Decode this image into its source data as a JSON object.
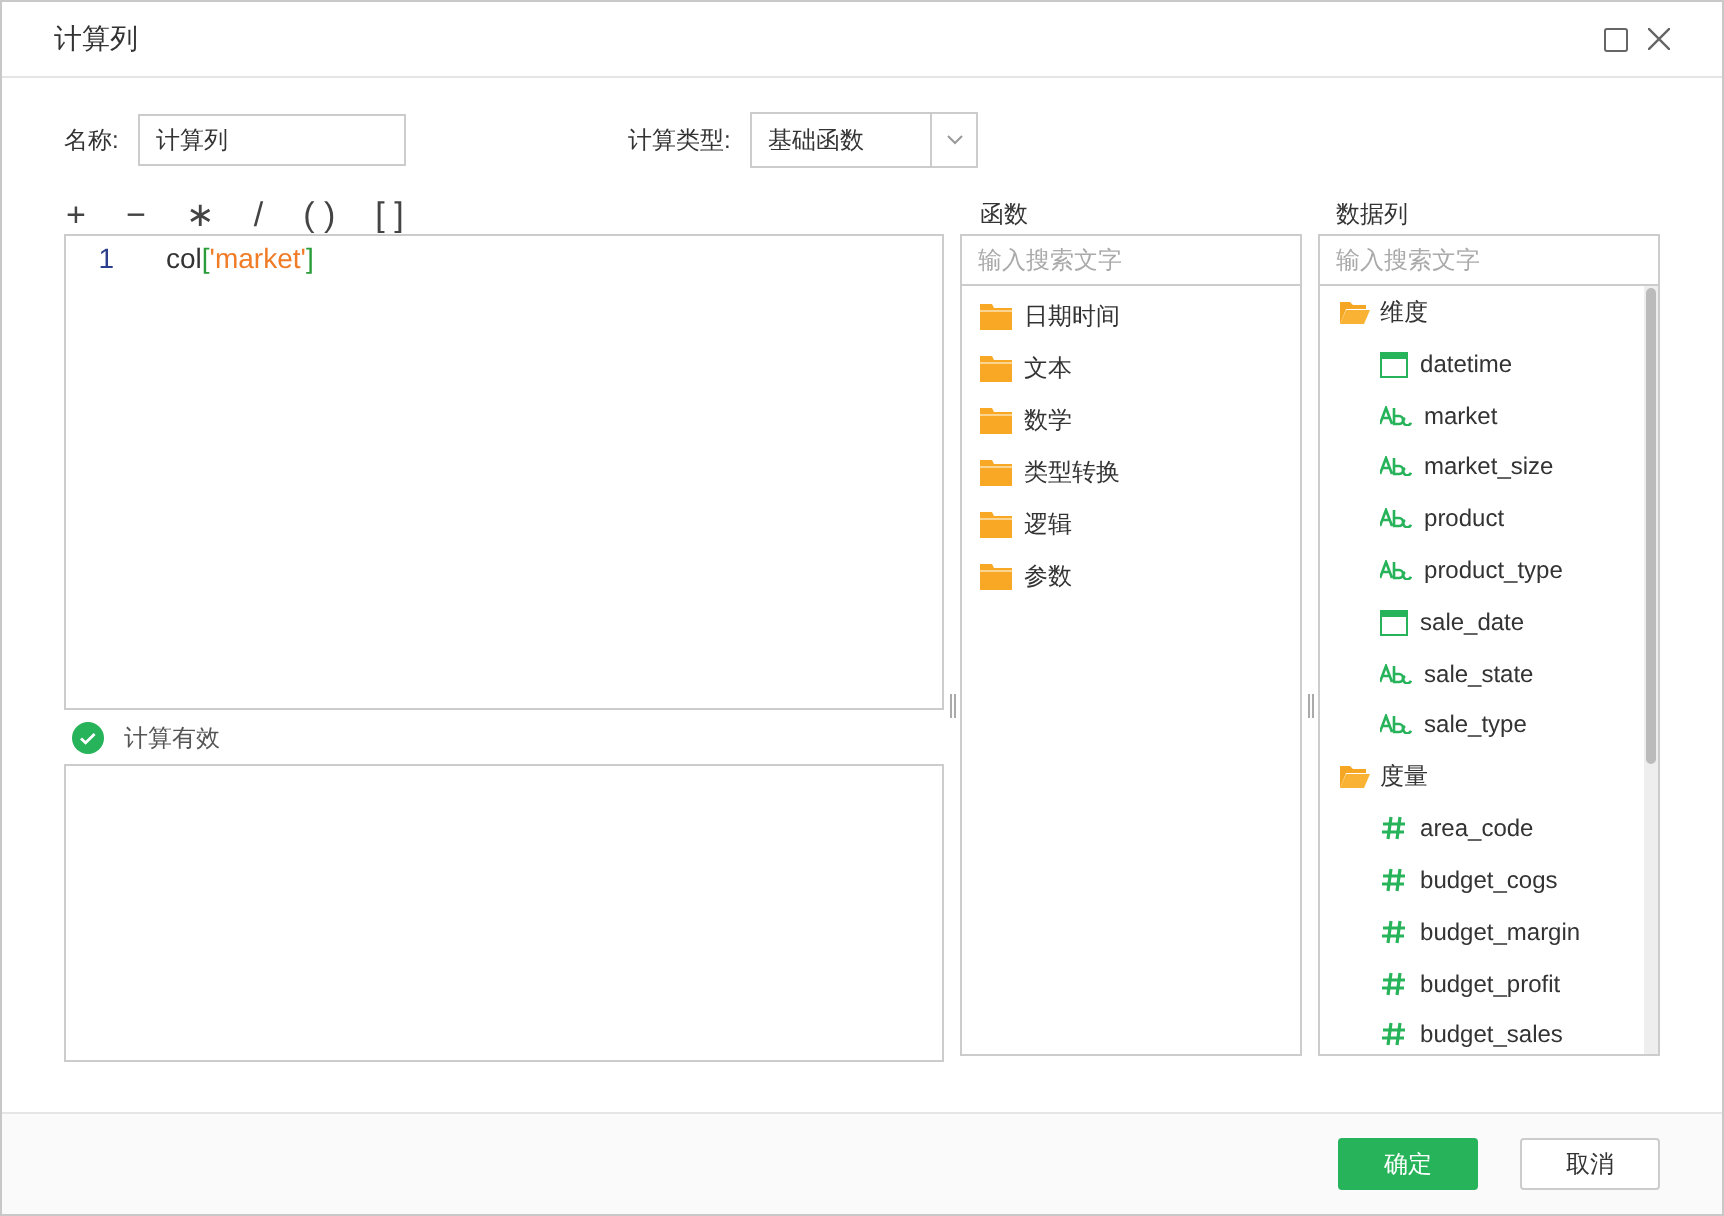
{
  "window": {
    "title": "计算列"
  },
  "name_field": {
    "label": "名称:",
    "value": "计算列"
  },
  "calc_type": {
    "label": "计算类型:",
    "value": "基础函数"
  },
  "operators": [
    "+",
    "−",
    "∗",
    "/",
    "( )",
    "[ ]"
  ],
  "editor": {
    "lines": [
      {
        "number": "1",
        "tokens": [
          {
            "kind": "ident",
            "text": "col"
          },
          {
            "kind": "bracket",
            "text": "["
          },
          {
            "kind": "string",
            "text": "'market'"
          },
          {
            "kind": "bracket",
            "text": "]"
          }
        ]
      }
    ]
  },
  "status": {
    "valid": true,
    "text": "计算有效"
  },
  "functions": {
    "title": "函数",
    "search_placeholder": "输入搜索文字",
    "items": [
      {
        "label": "日期时间",
        "expanded": false
      },
      {
        "label": "文本",
        "expanded": false
      },
      {
        "label": "数学",
        "expanded": false
      },
      {
        "label": "类型转换",
        "expanded": false
      },
      {
        "label": "逻辑",
        "expanded": false
      },
      {
        "label": "参数",
        "expanded": false
      }
    ]
  },
  "columns": {
    "title": "数据列",
    "search_placeholder": "输入搜索文字",
    "tree": [
      {
        "label": "维度",
        "expanded": true,
        "children": [
          {
            "label": "datetime",
            "kind": "date"
          },
          {
            "label": "market",
            "kind": "text"
          },
          {
            "label": "market_size",
            "kind": "text"
          },
          {
            "label": "product",
            "kind": "text"
          },
          {
            "label": "product_type",
            "kind": "text"
          },
          {
            "label": "sale_date",
            "kind": "date"
          },
          {
            "label": "sale_state",
            "kind": "text"
          },
          {
            "label": "sale_type",
            "kind": "text"
          }
        ]
      },
      {
        "label": "度量",
        "expanded": true,
        "children": [
          {
            "label": "area_code",
            "kind": "number"
          },
          {
            "label": "budget_cogs",
            "kind": "number"
          },
          {
            "label": "budget_margin",
            "kind": "number"
          },
          {
            "label": "budget_profit",
            "kind": "number"
          },
          {
            "label": "budget_sales",
            "kind": "number"
          }
        ]
      }
    ]
  },
  "buttons": [
    {
      "label": "确定",
      "kind": "primary"
    },
    {
      "label": "取消",
      "kind": "secondary"
    }
  ]
}
